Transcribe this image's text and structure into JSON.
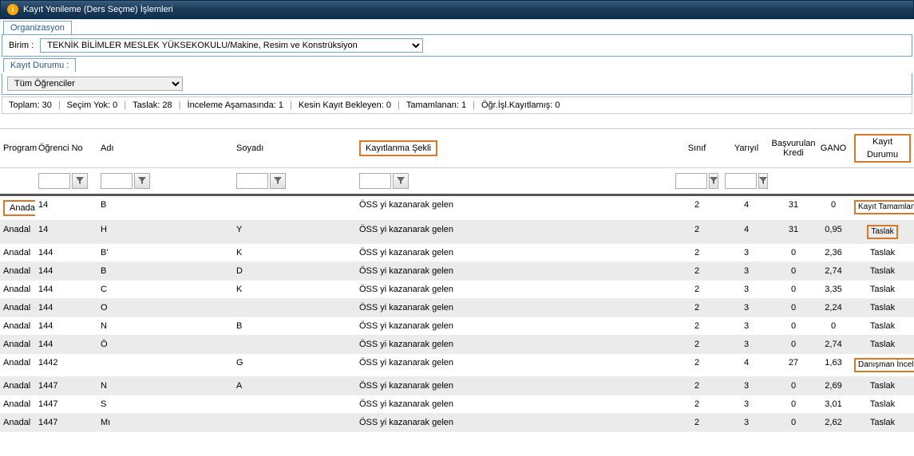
{
  "window": {
    "title": "Kayıt Yenileme (Ders Seçme) İşlemleri"
  },
  "tabs": {
    "organizasyon": "Organizasyon"
  },
  "org": {
    "birim_label": "Birim :",
    "birim_value": "TEKNİK BİLİMLER MESLEK YÜKSEKOKULU/Makine, Resim ve Konstrüksiyon"
  },
  "kayit_durumu": {
    "tab": "Kayıt Durumu :",
    "select_value": "Tüm Öğrenciler"
  },
  "stats": {
    "toplam": "Toplam: 30",
    "secim_yok": "Seçim Yok: 0",
    "taslak": "Taslak: 28",
    "inceleme": "İnceleme Aşamasında: 1",
    "kesin": "Kesin Kayıt Bekleyen: 0",
    "tamamlanan": "Tamamlanan: 1",
    "ogrisl": "Öğr.İşl.Kayıtlamış: 0"
  },
  "headers": {
    "program": "Program",
    "ogrno": "Öğrenci No",
    "adi": "Adı",
    "soyadi": "Soyadı",
    "kayitlanma": "Kayıtlanma Şekli",
    "sinif": "Sınıf",
    "yariyil": "Yarıyıl",
    "kredi": "Başvurulan Kredi",
    "gano": "GANO",
    "kdurum": "Kayıt Durumu"
  },
  "rows": [
    {
      "program": "Anadal",
      "ogrno": "14",
      "adi": "B",
      "soyad": "",
      "sekli": "ÖSS yi kazanarak gelen",
      "sinif": "2",
      "yariyil": "4",
      "kredi": "31",
      "gano": "0",
      "durum": "Kayıt Tamamlandı",
      "hl": true
    },
    {
      "program": "Anadal",
      "ogrno": "14",
      "adi": "H",
      "soyad": "Y",
      "sekli": "ÖSS yi kazanarak gelen",
      "sinif": "2",
      "yariyil": "4",
      "kredi": "31",
      "gano": "0,95",
      "durum": "Taslak",
      "hl": true
    },
    {
      "program": "Anadal",
      "ogrno": "144",
      "adi": "B'",
      "soyad": "K",
      "sekli": "ÖSS yi kazanarak gelen",
      "sinif": "2",
      "yariyil": "3",
      "kredi": "0",
      "gano": "2,36",
      "durum": "Taslak"
    },
    {
      "program": "Anadal",
      "ogrno": "144",
      "adi": "B",
      "soyad": "D",
      "sekli": "ÖSS yi kazanarak gelen",
      "sinif": "2",
      "yariyil": "3",
      "kredi": "0",
      "gano": "2,74",
      "durum": "Taslak"
    },
    {
      "program": "Anadal",
      "ogrno": "144",
      "adi": "C",
      "soyad": "K",
      "sekli": "ÖSS yi kazanarak gelen",
      "sinif": "2",
      "yariyil": "3",
      "kredi": "0",
      "gano": "3,35",
      "durum": "Taslak"
    },
    {
      "program": "Anadal",
      "ogrno": "144",
      "adi": "O",
      "soyad": "",
      "sekli": "ÖSS yi kazanarak gelen",
      "sinif": "2",
      "yariyil": "3",
      "kredi": "0",
      "gano": "2,24",
      "durum": "Taslak"
    },
    {
      "program": "Anadal",
      "ogrno": "144",
      "adi": "N",
      "soyad": "B",
      "sekli": "ÖSS yi kazanarak gelen",
      "sinif": "2",
      "yariyil": "3",
      "kredi": "0",
      "gano": "0",
      "durum": "Taslak"
    },
    {
      "program": "Anadal",
      "ogrno": "144",
      "adi": "Ö",
      "soyad": "",
      "sekli": "ÖSS yi kazanarak gelen",
      "sinif": "2",
      "yariyil": "3",
      "kredi": "0",
      "gano": "2,74",
      "durum": "Taslak"
    },
    {
      "program": "Anadal",
      "ogrno": "1442",
      "adi": "",
      "soyad": "G",
      "sekli": "ÖSS yi kazanarak gelen",
      "sinif": "2",
      "yariyil": "4",
      "kredi": "27",
      "gano": "1,63",
      "durum": "Danışman İnceleme",
      "hl": true
    },
    {
      "program": "Anadal",
      "ogrno": "1447",
      "adi": "N",
      "soyad": "A",
      "sekli": "ÖSS yi kazanarak gelen",
      "sinif": "2",
      "yariyil": "3",
      "kredi": "0",
      "gano": "2,69",
      "durum": "Taslak"
    },
    {
      "program": "Anadal",
      "ogrno": "1447",
      "adi": "S",
      "soyad": "",
      "sekli": "ÖSS yi kazanarak gelen",
      "sinif": "2",
      "yariyil": "3",
      "kredi": "0",
      "gano": "3,01",
      "durum": "Taslak"
    },
    {
      "program": "Anadal",
      "ogrno": "1447",
      "adi": "Mı",
      "soyad": "",
      "sekli": "ÖSS yi kazanarak gelen",
      "sinif": "2",
      "yariyil": "3",
      "kredi": "0",
      "gano": "2,62",
      "durum": "Taslak"
    }
  ]
}
